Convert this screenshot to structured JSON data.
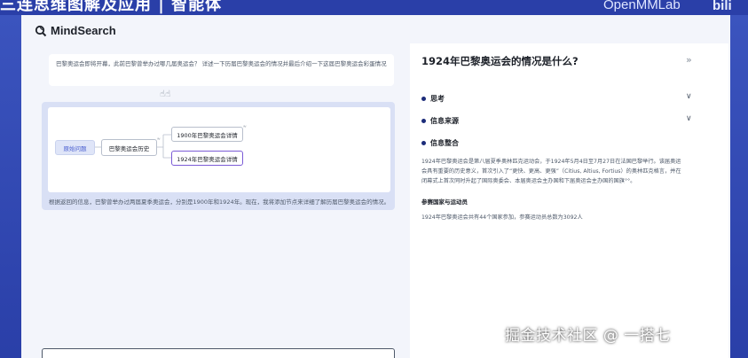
{
  "video": {
    "banner_text": "三连思维图解及应用 | 智能体",
    "brand": "OpenMMLab",
    "bili_logo": "bili"
  },
  "app": {
    "logo_text": "MindSearch",
    "logo_icon": "search-icon"
  },
  "question": {
    "text": "巴黎奥运会即将开幕，此前巴黎曾举办过哪几届奥运会？ 详述一下历届巴黎奥运会的情况并最后介绍一下这届巴黎奥运会彩蛋情况"
  },
  "cursor_hint": "☝☝",
  "graph": {
    "nodes": {
      "root": "原始问题",
      "history": "巴黎奥运会历史",
      "n1900": "1900年巴黎奥运会详情",
      "n1924": "1924年巴黎奥运会详情"
    },
    "node_mark": "≈",
    "summary": "根据返回的信息，巴黎曾举办过两届夏季奥运会，分别是1900年和1924年。现在，我将添加节点来详细了解历届巴黎奥运会的情况。"
  },
  "answer": {
    "title": "1924年巴黎奥运会的情况是什么?",
    "collapse_icon": "double-chevron-right-icon",
    "sections": {
      "think": "思考",
      "sources": "信息来源",
      "integrate": "信息整合"
    },
    "paragraph": "1924年巴黎奥运会是第八届夏季奥林匹克运动会，于1924年5月4日至7月27日在法国巴黎举行。该届奥运会具有重要的历史意义，首次引入了“更快、更高、更强”（Citius, Altius, Fortius）的奥林匹克格言，并在闭幕式上首次同时升起了国际奥委会、本届奥运会主办国和下届奥运会主办国的国旗",
    "paragraph_suffix": "°°。",
    "subheading": "参赛国家与运动员",
    "subparagraph": "1924年巴黎奥运会共有44个国家参加，参赛运动员总数为3092人"
  },
  "watermark": "掘金技术社区 @ 一搭七",
  "colors": {
    "accent": "#4a5fd0",
    "selected_node_border": "#7b5bd6",
    "section_dot": "#1c2c7a",
    "video_frame": "#2a3fa8"
  }
}
